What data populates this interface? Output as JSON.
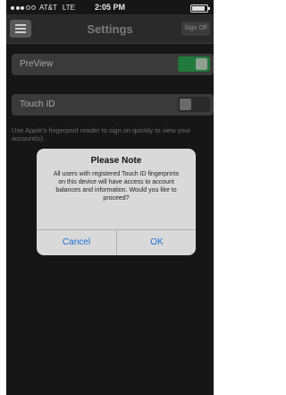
{
  "status_bar": {
    "carrier": "AT&T",
    "network": "LTE",
    "time": "2:05 PM"
  },
  "navbar": {
    "title": "Settings",
    "signoff_label": "Sign Off"
  },
  "settings": {
    "preview": {
      "label": "PreView",
      "enabled": true
    },
    "touch_id": {
      "label": "Touch ID",
      "enabled": false
    },
    "help_text": "Use Apple's fingerprint reader to sign on quickly to view your account(s)."
  },
  "alert": {
    "title": "Please Note",
    "message": "All users with registered Touch ID fingerprints on this device will have access to account balances and information. Would you like to proceed?",
    "cancel_label": "Cancel",
    "ok_label": "OK"
  },
  "colors": {
    "accent_blue": "#1a6fd6",
    "toggle_on": "#217a3c"
  }
}
